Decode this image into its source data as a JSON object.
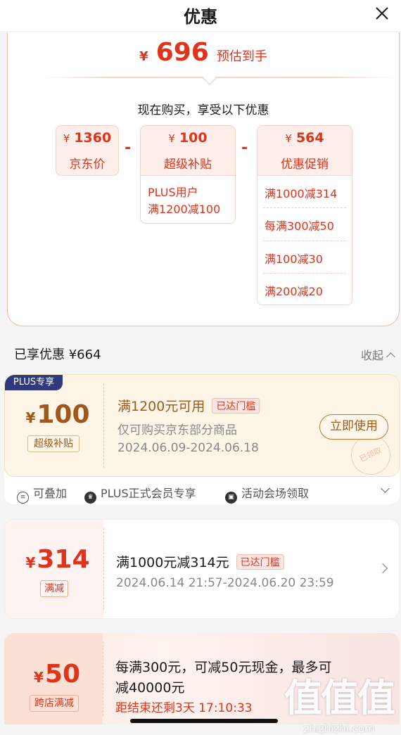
{
  "header": {
    "title": "优惠"
  },
  "summary": {
    "currency": "¥",
    "final_price": "696",
    "final_label": "预估到手",
    "buy_now_text": "现在购买，享受以下优惠",
    "minus_sign": "-",
    "boxes": [
      {
        "value": "1360",
        "label": "京东价",
        "details": []
      },
      {
        "value": "100",
        "label": "超级补贴",
        "details": [
          "PLUS用户",
          "满1200减100"
        ]
      },
      {
        "value": "564",
        "label": "优惠促销",
        "details": [
          "满1000减314",
          "每满300减50",
          "满100减30",
          "满200减20"
        ]
      }
    ]
  },
  "section": {
    "title": "已享优惠 ¥664",
    "collapse_label": "收起"
  },
  "coupons": [
    {
      "tag": "PLUS专享",
      "currency": "¥",
      "amount": "100",
      "type_label": "超级补贴",
      "condition": "满1200元可用",
      "status": "已达门槛",
      "desc": "仅可购买京东部分商品",
      "period": "2024.06.09-2024.06.18",
      "action": "立即使用",
      "stamp": "已领取",
      "perks": [
        "可叠加",
        "PLUS正式会员专享",
        "活动会场领取"
      ]
    },
    {
      "currency": "¥",
      "amount": "314",
      "type_label": "满减",
      "condition": "满1000元减314元",
      "status": "已达门槛",
      "period": "2024.06.14 21:57-2024.06.20 23:59"
    },
    {
      "currency": "¥",
      "amount": "50",
      "type_label": "跨店满减",
      "condition_line1": "每满300元，可减50元现金，最多可",
      "condition_line2": "减40000元",
      "countdown": "距结束还剩3天 17:10:33"
    }
  ],
  "watermark": {
    "logo": "值值值",
    "url": "zhizhizhi.com"
  },
  "colors": {
    "accent": "#e0331c",
    "gold": "#9a5a1e",
    "plus_navy": "#2f3a7d"
  }
}
